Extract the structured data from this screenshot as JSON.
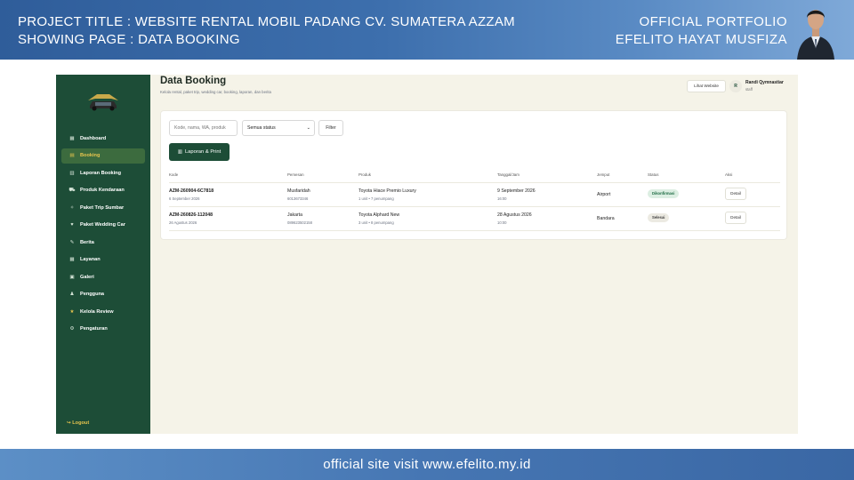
{
  "banner": {
    "project_title": "PROJECT TITLE : WEBSITE RENTAL MOBIL PADANG CV. SUMATERA AZZAM",
    "showing_page": "SHOWING PAGE : DATA BOOKING",
    "portfolio": "OFFICIAL PORTFOLIO",
    "author": "EFELITO HAYAT MUSFIZA",
    "footer": "official site visit www.efelito.my.id"
  },
  "sidebar": {
    "items": [
      {
        "label": "Dashboard",
        "icon": "grid-icon",
        "glyph": "▦"
      },
      {
        "label": "Booking",
        "icon": "calendar-icon",
        "glyph": "▤",
        "active": true
      },
      {
        "label": "Laporan Booking",
        "icon": "report-icon",
        "glyph": "▥"
      },
      {
        "label": "Produk Kendaraan",
        "icon": "car-icon",
        "glyph": "⛟"
      },
      {
        "label": "Paket Trip Sumbar",
        "icon": "compass-icon",
        "glyph": "✧"
      },
      {
        "label": "Paket Wedding Car",
        "icon": "wedding-car-icon",
        "glyph": "♥"
      },
      {
        "label": "Berita",
        "icon": "pen-icon",
        "glyph": "✎"
      },
      {
        "label": "Layanan",
        "icon": "services-icon",
        "glyph": "▦"
      },
      {
        "label": "Galeri",
        "icon": "gallery-icon",
        "glyph": "▣"
      },
      {
        "label": "Pengguna",
        "icon": "user-icon",
        "glyph": "♟"
      },
      {
        "label": "Kelola Review",
        "icon": "star-icon",
        "glyph": "★"
      },
      {
        "label": "Pengaturan",
        "icon": "gear-icon",
        "glyph": "⚙"
      }
    ],
    "logout": "Logout",
    "logout_glyph": "↪"
  },
  "header": {
    "title": "Data Booking",
    "subtitle": "Kelola rental, paket trip, wedding car, booking, laporan, dan berita",
    "lihat_website": "Lihat Website",
    "avatar_initial": "R",
    "user_name": "Randi Qymnastiar",
    "user_role": "staff"
  },
  "filters": {
    "search_placeholder": "Kode, nama, WA, produk",
    "status_value": "Semua status",
    "filter_label": "Filter",
    "laporan_label": "Laporan & Print"
  },
  "table": {
    "headers": [
      "Kode",
      "Pemesan",
      "Produk",
      "Tanggal/Jam",
      "Jemput",
      "Status",
      "Aksi"
    ],
    "rows": [
      {
        "kode": "AZM-260904-6C7818",
        "kode_date": "6 September 2026",
        "pemesan": "Musfaridah",
        "pemesan_phone": "6013673346",
        "produk": "Toyota Hiace Premio Luxury",
        "produk_detail": "1 unit • 7 penumpang",
        "tanggal": "9 September 2026",
        "jam": "16:00",
        "jemput": "Airport",
        "status": "Dikonfirmasi",
        "aksi": "Detail"
      },
      {
        "kode": "AZM-260826-112048",
        "kode_date": "26 Agustus 2026",
        "pemesan": "Jakarta",
        "pemesan_phone": "089623502158",
        "produk": "Toyota Alphard New",
        "produk_detail": "3 unit • 8 penumpang",
        "tanggal": "28 Agustus 2026",
        "jam": "10:00",
        "jemput": "Bandara",
        "status": "Selesai",
        "aksi": "Detail"
      }
    ]
  },
  "colors": {
    "sidebar": "#1d4d37",
    "accent_gold": "#e7c54e",
    "content_bg": "#f5f3e8",
    "banner_blue": "#3d6fad"
  }
}
